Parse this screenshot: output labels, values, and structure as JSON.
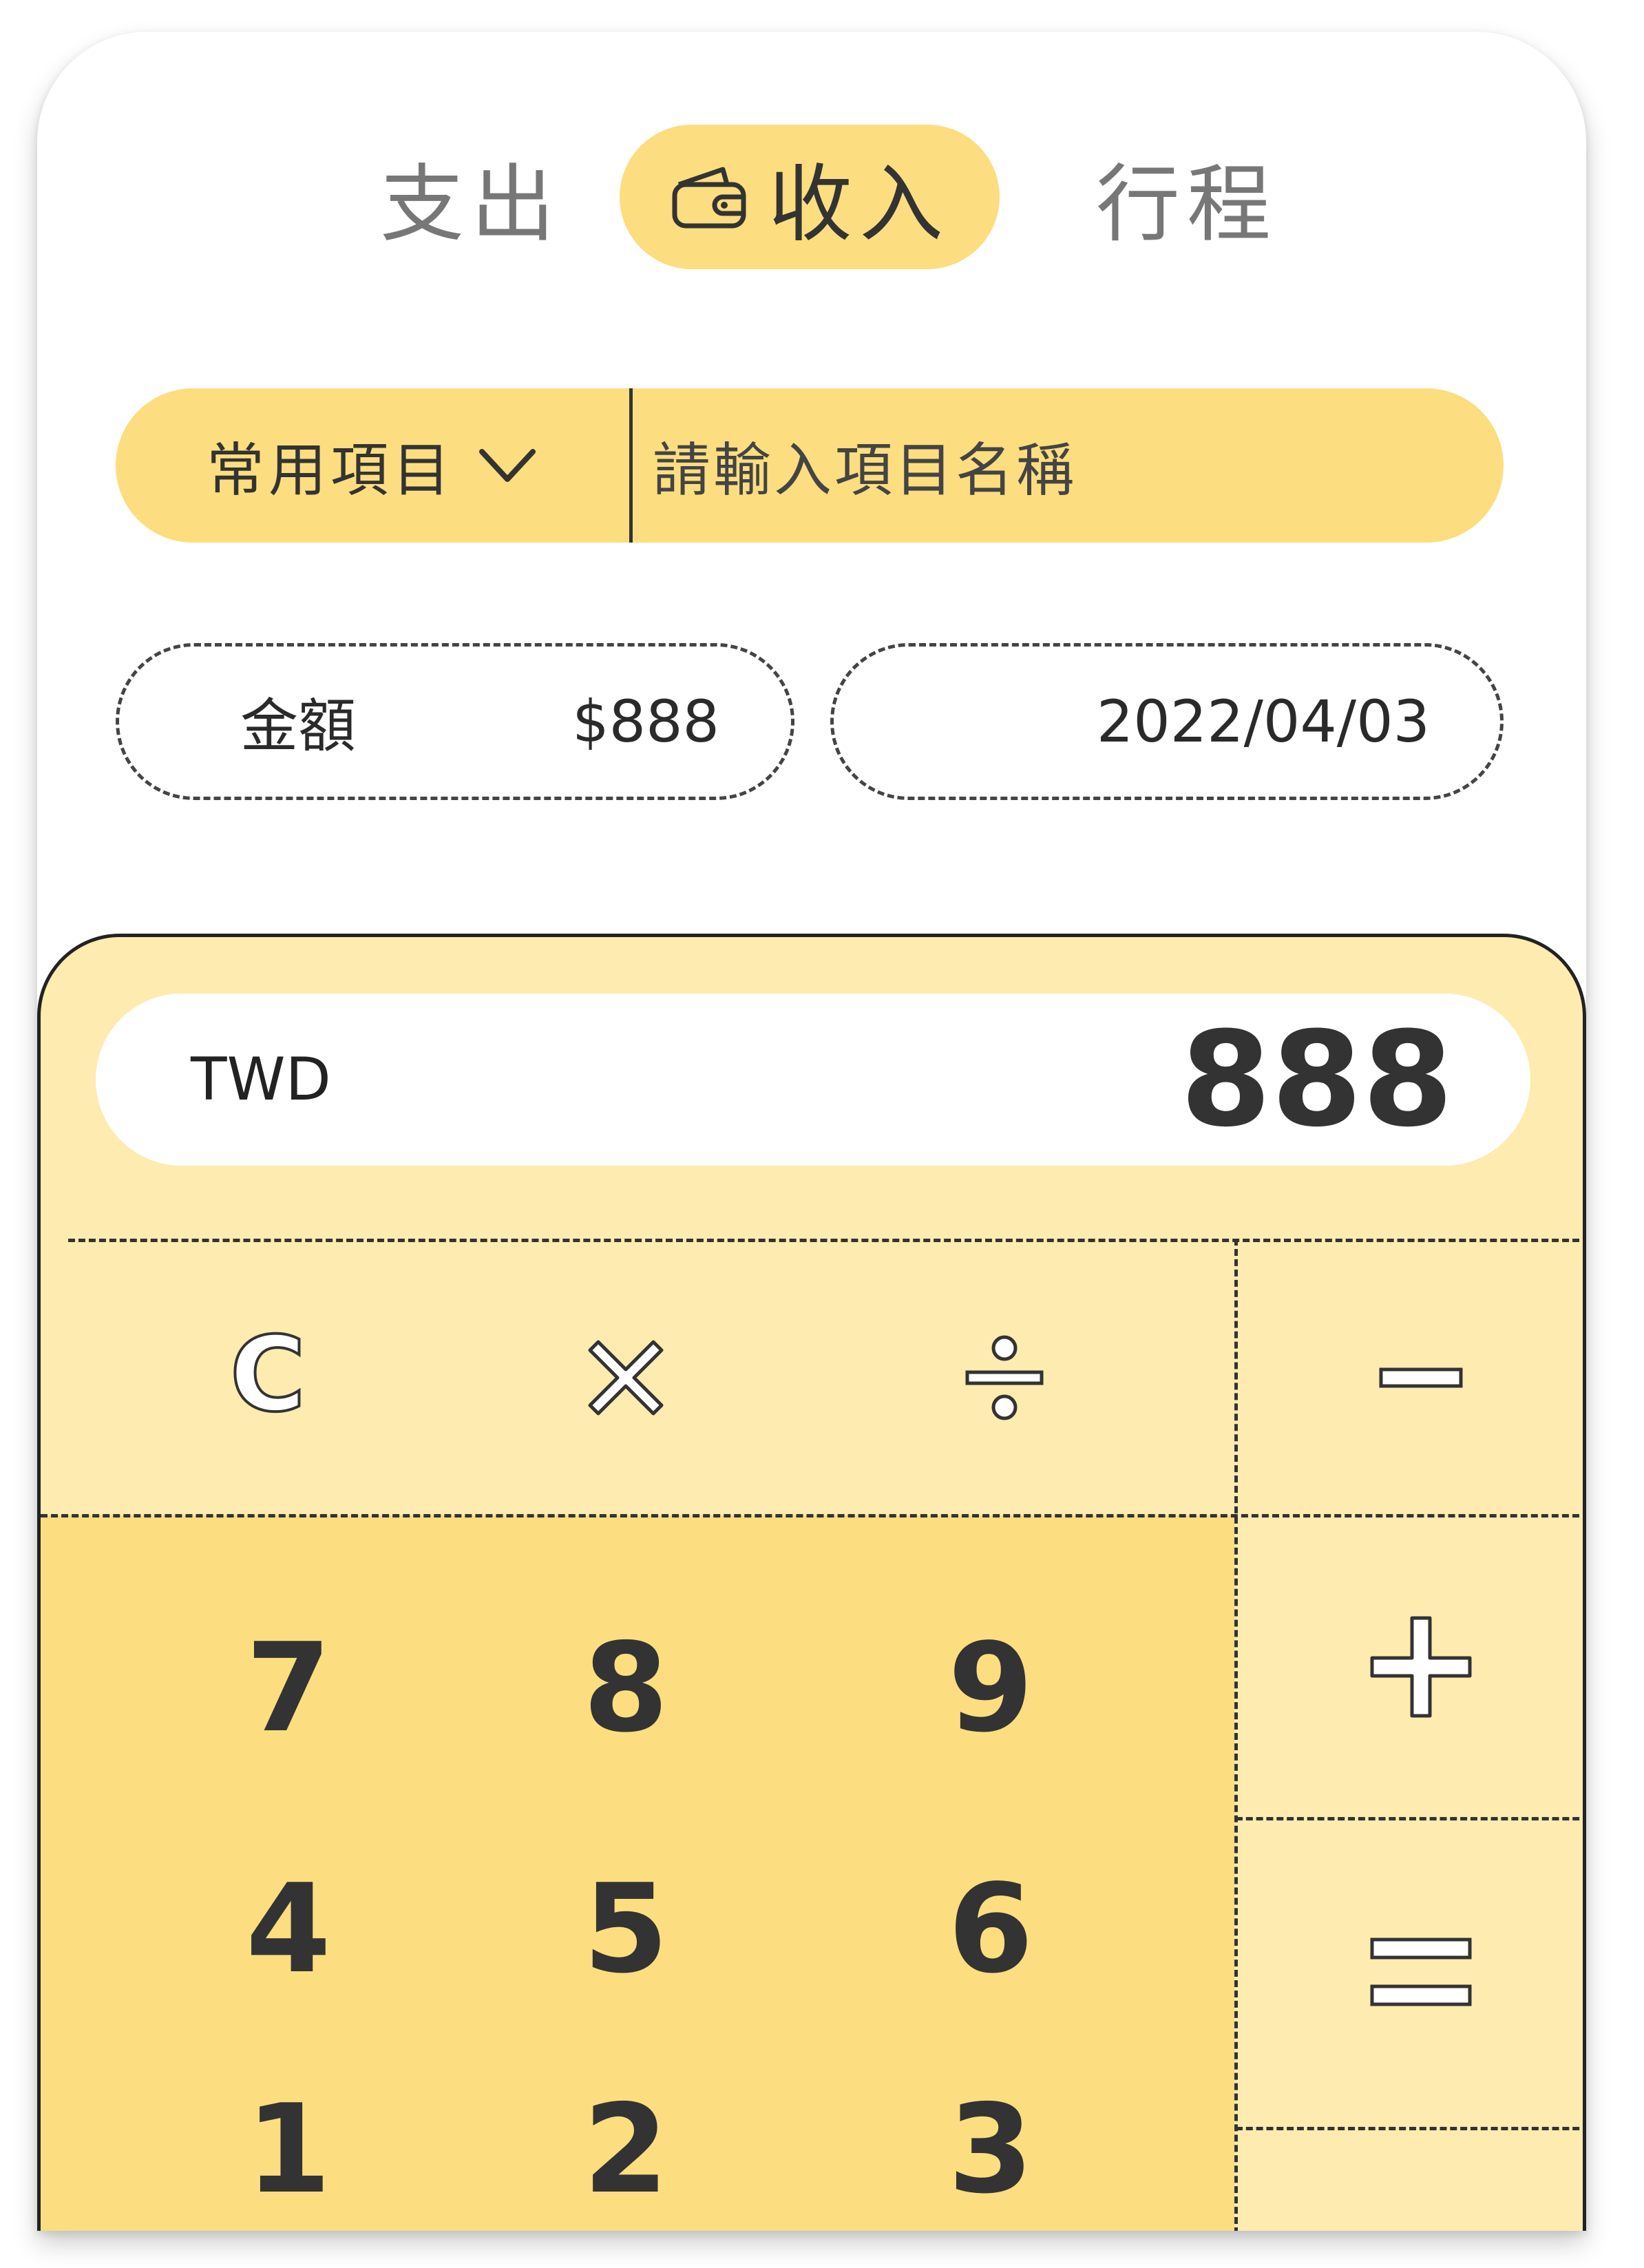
{
  "tabs": [
    {
      "label": "支出",
      "active": false
    },
    {
      "label": "收入",
      "active": true,
      "icon": "wallet-icon"
    },
    {
      "label": "行程",
      "active": false
    }
  ],
  "item_selector": {
    "category_label": "常用項目",
    "category_icon": "chevron-down-icon",
    "name_placeholder": "請輸入項目名稱"
  },
  "amount": {
    "label": "金額",
    "value": "$888"
  },
  "date": {
    "value": "2022/04/03"
  },
  "calculator": {
    "currency": "TWD",
    "display_value": "888",
    "keys": {
      "clear": "C",
      "multiply": "×",
      "divide": "÷",
      "minus": "−",
      "plus": "+",
      "equals": "=",
      "digits": [
        "7",
        "8",
        "9",
        "4",
        "5",
        "6",
        "1",
        "2",
        "3"
      ]
    }
  },
  "colors": {
    "accent": "#FCDE80",
    "calculator_light": "#FDEBB0",
    "text_dark": "#333333",
    "text_muted": "#777777"
  }
}
